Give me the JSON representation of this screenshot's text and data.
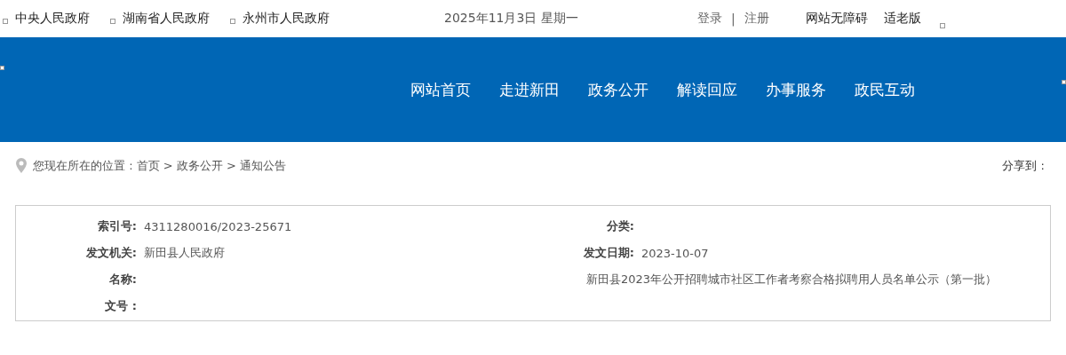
{
  "top_links": [
    {
      "label": "中央人民政府"
    },
    {
      "label": "湖南省人民政府"
    },
    {
      "label": "永州市人民政府"
    }
  ],
  "date": "2025年11月3日 星期一",
  "account": {
    "login": "登录",
    "separator": "|",
    "register": "注册"
  },
  "tools": [
    "网站无障碍",
    "适老版"
  ],
  "nav": [
    {
      "label": "网站首页"
    },
    {
      "label": "走进新田"
    },
    {
      "label": "政务公开"
    },
    {
      "label": "解读回应"
    },
    {
      "label": "办事服务"
    },
    {
      "label": "政民互动"
    }
  ],
  "breadcrumb": "您现在所在的位置 : 首页 > 政务公开 > 通知公告",
  "share": "分享到 :",
  "info": [
    {
      "kind": "field",
      "label": "索引号:",
      "value": "4311280016/2023-25671"
    },
    {
      "kind": "field",
      "label": "分类:"
    },
    {
      "kind": "field",
      "label": "发文机关:",
      "value": "新田县人民政府"
    },
    {
      "kind": "field",
      "label": "发文日期:",
      "value": "2023-10-07"
    },
    {
      "kind": "wide",
      "label": "名称:",
      "value": "新田县2023年公开招聘城市社区工作者考察合格拟聘用人员名单公示（第一批）"
    },
    {
      "kind": "field",
      "label": "文号 :"
    }
  ]
}
